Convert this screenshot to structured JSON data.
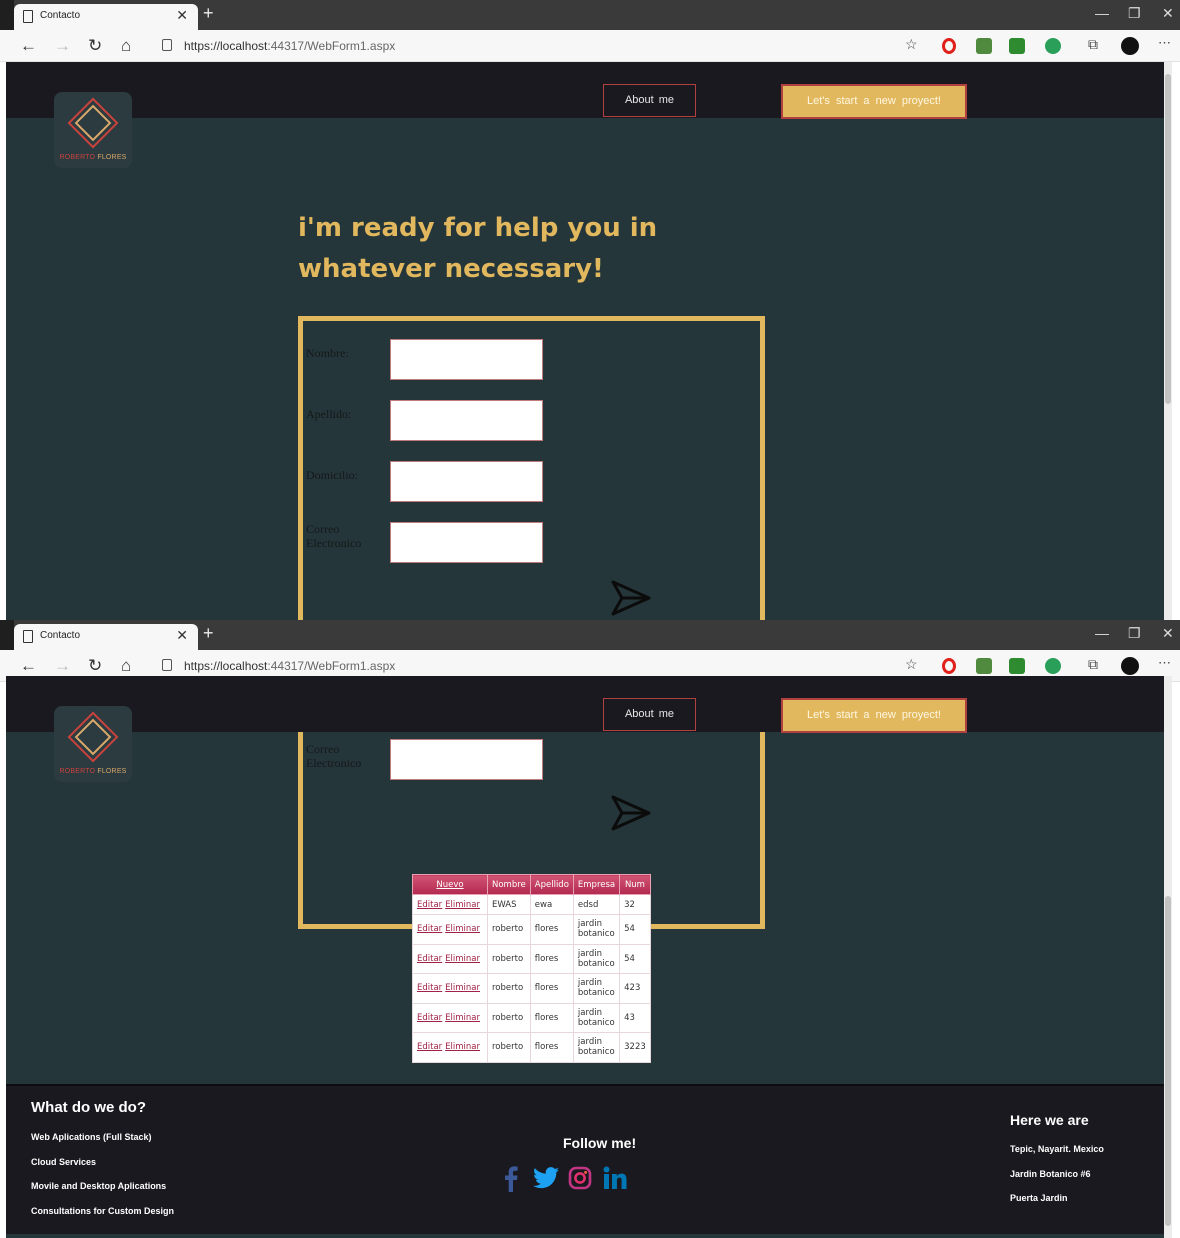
{
  "browser": {
    "tab_title": "Contacto",
    "url_host": "https://localhost",
    "url_path": ":44317/WebForm1.aspx"
  },
  "site": {
    "logo_brand_first": "ROBERTO",
    "logo_brand_last": " FLORES",
    "nav_about": "About me",
    "nav_start": "Let's start a new proyect!",
    "hero_line1": "i'm ready for help you in",
    "hero_line2": "whatever necessary!"
  },
  "form": {
    "fields": [
      {
        "label": "Nombre:",
        "value": ""
      },
      {
        "label": "Apellido:",
        "value": ""
      },
      {
        "label": "Domicilio:",
        "value": ""
      },
      {
        "label": "Correo Electronico",
        "value": ""
      }
    ]
  },
  "grid": {
    "columns": [
      "Nuevo",
      "Nombre",
      "Apellido",
      "Empresa",
      "Num"
    ],
    "edit_label": "Editar",
    "delete_label": "Eliminar",
    "rows": [
      {
        "nombre": "EWAS",
        "apellido": "ewa",
        "empresa": "edsd",
        "num": "32"
      },
      {
        "nombre": "roberto",
        "apellido": "flores",
        "empresa": "jardin botanico",
        "num": "54"
      },
      {
        "nombre": "roberto",
        "apellido": "flores",
        "empresa": "jardin botanico",
        "num": "54"
      },
      {
        "nombre": "roberto",
        "apellido": "flores",
        "empresa": "jardin botanico",
        "num": "423"
      },
      {
        "nombre": "roberto",
        "apellido": "flores",
        "empresa": "jardin botanico",
        "num": "43"
      },
      {
        "nombre": "roberto",
        "apellido": "flores",
        "empresa": "jardin botanico",
        "num": "3223"
      }
    ]
  },
  "footer": {
    "what_title": "What do we do?",
    "services": [
      "Web Aplications (Full Stack)",
      "Cloud Services",
      "Movile and Desktop Aplications",
      "Consultations for Custom Design"
    ],
    "follow_title": "Follow me!",
    "location_title": "Here we are",
    "location_lines": [
      "Tepic, Nayarit. Mexico",
      "Jardin Botanico #6",
      "Puerta Jardin"
    ]
  },
  "colors": {
    "page_bg": "#25363a",
    "header_bg": "#1a1920",
    "accent_gold": "#e2b85e",
    "accent_red": "#b14040",
    "grid_header": "#c0375a"
  }
}
